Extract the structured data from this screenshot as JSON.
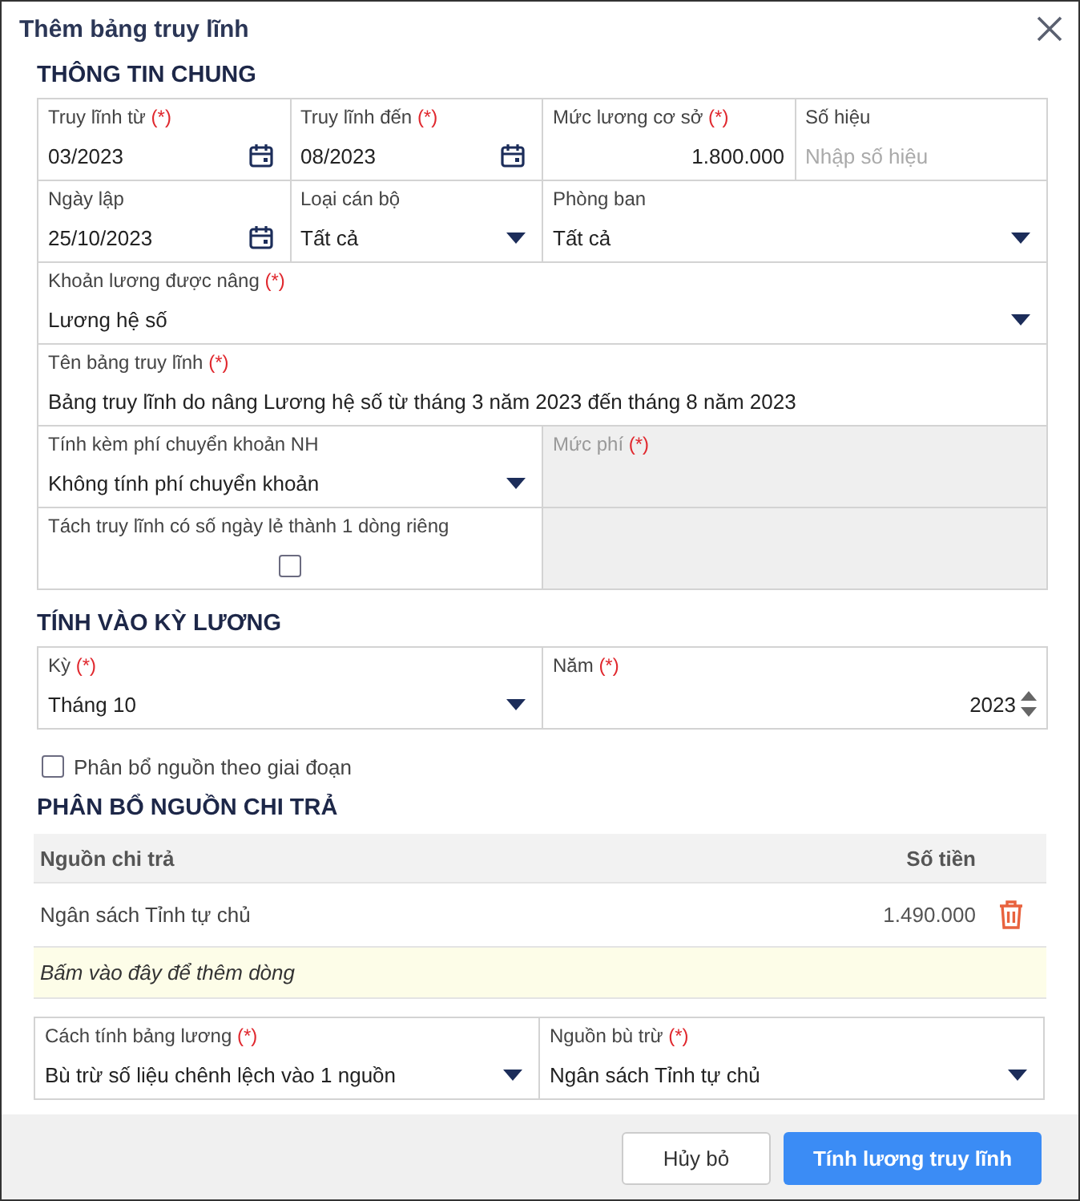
{
  "dialog": {
    "title": "Thêm bảng truy lĩnh"
  },
  "general": {
    "heading": "THÔNG TIN CHUNG",
    "rows": [
      {
        "fields": [
          {
            "kind": "date",
            "label": "Truy lĩnh từ",
            "required_mark": "(*)",
            "value": "03/2023",
            "disabled": false
          },
          {
            "kind": "date",
            "label": "Truy lĩnh đến",
            "required_mark": "(*)",
            "value": "08/2023",
            "disabled": false
          },
          {
            "kind": "number",
            "label": "Mức lương cơ sở",
            "required_mark": "(*)",
            "value": "1.800.000",
            "disabled": false
          },
          {
            "kind": "text",
            "label": "Số hiệu",
            "placeholder": "Nhập số hiệu",
            "disabled": false
          }
        ]
      },
      {
        "fields": [
          {
            "kind": "date",
            "label": "Ngày lập",
            "value": "25/10/2023",
            "disabled": false
          },
          {
            "kind": "select",
            "label": "Loại cán bộ",
            "value": "Tất cả",
            "disabled": false
          },
          {
            "kind": "select",
            "label": "Phòng ban",
            "value": "Tất cả",
            "disabled": false
          }
        ]
      },
      {
        "fields": [
          {
            "kind": "select",
            "label": "Khoản lương được nâng",
            "required_mark": "(*)",
            "value": "Lương hệ số",
            "disabled": false
          }
        ]
      },
      {
        "fields": [
          {
            "kind": "text",
            "label": "Tên bảng truy lĩnh",
            "required_mark": "(*)",
            "value": "Bảng truy lĩnh do nâng Lương hệ số từ tháng 3 năm 2023 đến tháng 8 năm 2023",
            "disabled": false
          }
        ]
      },
      {
        "fields": [
          {
            "kind": "select",
            "label": "Tính kèm phí chuyển khoản NH",
            "value": "Không tính phí chuyển khoản",
            "disabled": false
          },
          {
            "kind": "text",
            "label": "Mức phí",
            "required_mark": "(*)",
            "disabled": true
          }
        ]
      },
      {
        "fields": [
          {
            "kind": "checkbox",
            "label": "Tách truy lĩnh có số ngày lẻ thành 1 dòng riêng",
            "checked": false,
            "disabled": false
          },
          {
            "kind": "blank",
            "disabled": true
          }
        ]
      }
    ]
  },
  "period": {
    "heading": "TÍNH VÀO KỲ LƯƠNG",
    "rows": [
      {
        "fields": [
          {
            "kind": "select",
            "label": "Kỳ",
            "required_mark": "(*)",
            "value": "Tháng 10",
            "disabled": false
          },
          {
            "kind": "spinner",
            "label": "Năm",
            "required_mark": "(*)",
            "value": "2023",
            "disabled": false
          }
        ]
      }
    ]
  },
  "split_by_stage": {
    "label": "Phân bổ nguồn theo giai đoạn",
    "checked": false
  },
  "sources": {
    "heading": "PHÂN BỔ NGUỒN CHI TRẢ",
    "columns": [
      "Nguồn chi trả",
      "Số tiền"
    ],
    "rows": [
      {
        "source": "Ngân sách Tỉnh tự chủ",
        "amount": "1.490.000"
      }
    ],
    "add_row_hint": "Bấm vào đây để thêm dòng"
  },
  "calculation": {
    "rows": [
      {
        "fields": [
          {
            "kind": "select",
            "label": "Cách tính bảng lương",
            "required_mark": "(*)",
            "value": "Bù trừ số liệu chênh lệch vào 1 nguồn",
            "disabled": false
          },
          {
            "kind": "select",
            "label": "Nguồn bù trừ",
            "required_mark": "(*)",
            "value": "Ngân sách Tỉnh tự chủ",
            "disabled": false
          }
        ]
      }
    ]
  },
  "buttons": [
    {
      "label": "Hủy bỏ",
      "kind": "secondary"
    },
    {
      "label": "Tính lương truy lĩnh",
      "kind": "primary"
    }
  ]
}
